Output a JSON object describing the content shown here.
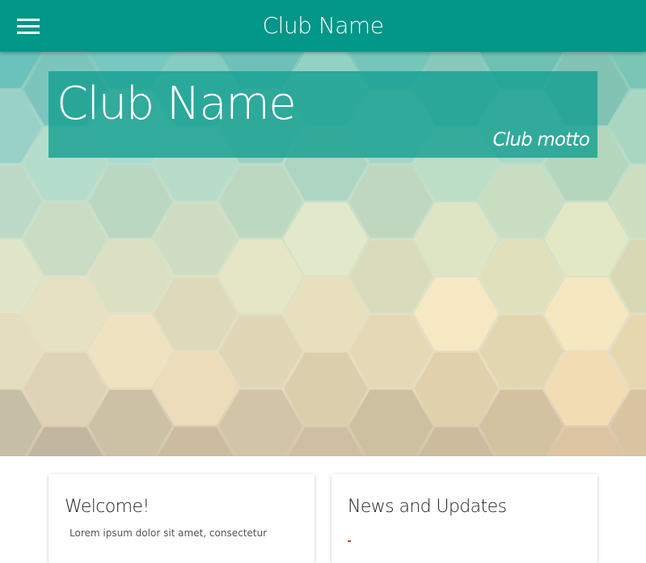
{
  "appbar": {
    "title": "Club Name",
    "background": "#009688",
    "menu_icon": "hamburger-menu-icon"
  },
  "hero": {
    "title": "Club Name",
    "motto": "Club motto",
    "banner_color": "#16a091"
  },
  "cards": {
    "welcome": {
      "title": "Welcome!",
      "body": "Lorem ipsum dolor sit amet, consectetur"
    },
    "news": {
      "title": "News and Updates",
      "accent_color": "#e53935"
    }
  }
}
